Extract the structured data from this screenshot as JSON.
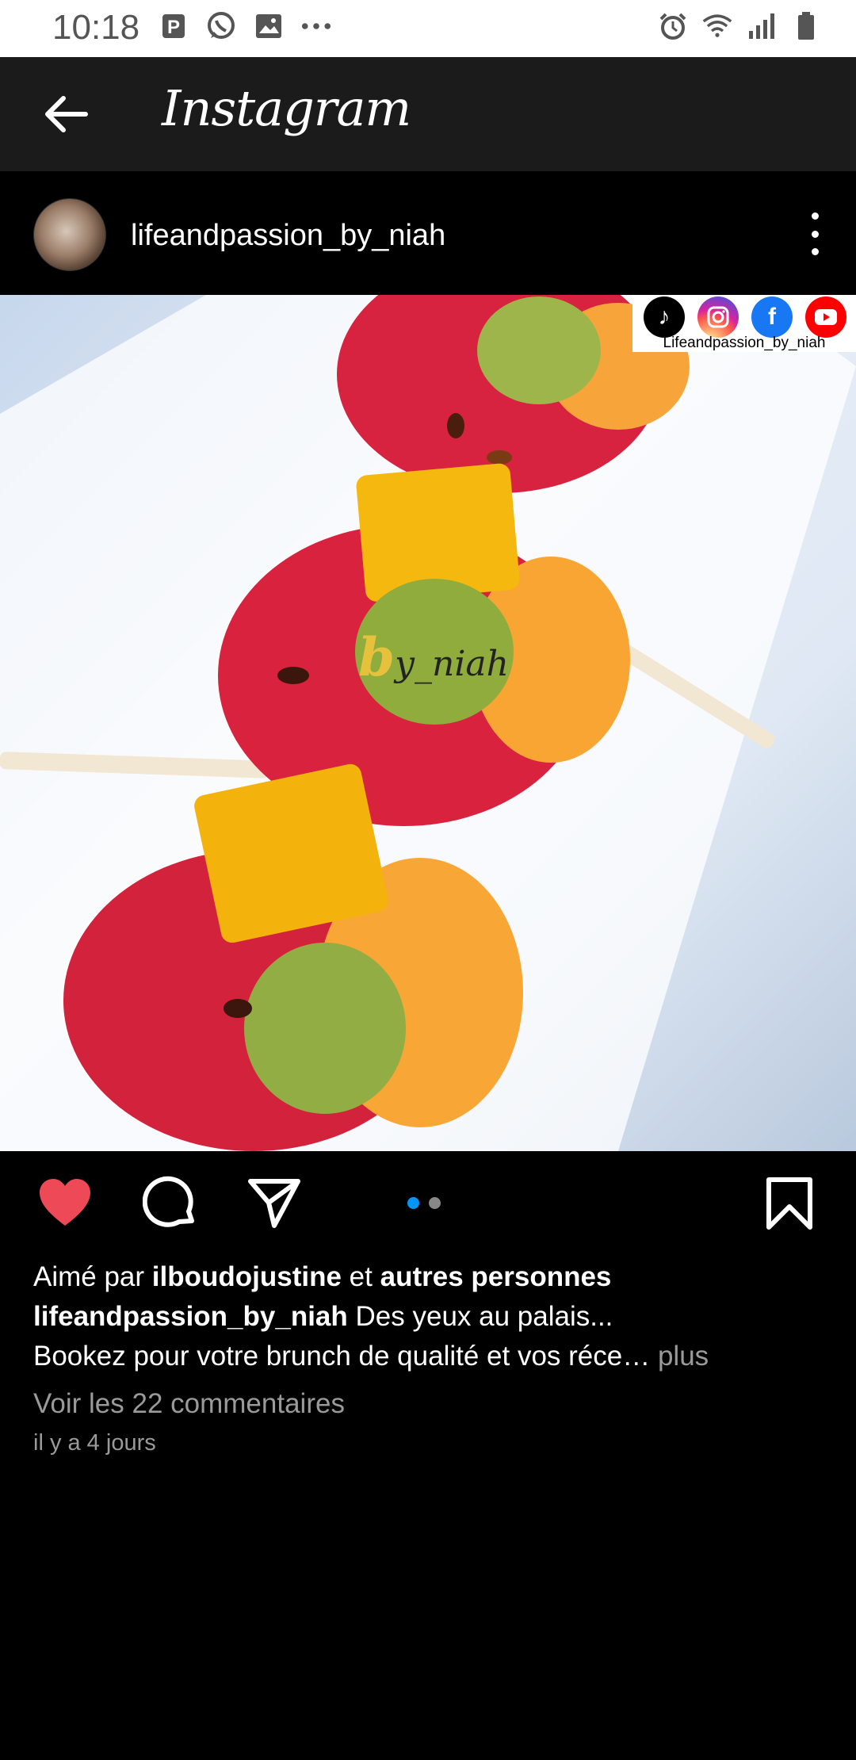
{
  "status_bar": {
    "time": "10:18",
    "left_icons": [
      "p-icon",
      "whatsapp-icon",
      "gallery-icon",
      "more-dots-icon"
    ],
    "right_icons": [
      "alarm-icon",
      "wifi-icon",
      "signal-icon",
      "battery-icon"
    ]
  },
  "app_bar": {
    "title": "Instagram"
  },
  "post": {
    "username": "lifeandpassion_by_niah",
    "watermark_text": "Lifeandpassion_by_niah",
    "overlay_brand_prefix": "b",
    "overlay_brand_rest": "y_niah",
    "carousel_count": 2,
    "carousel_active_index": 0,
    "liked_by_prefix": "Aimé par",
    "liked_by_user": "ilboudojustine",
    "liked_by_joiner": "et",
    "liked_by_others": "autres personnes",
    "caption_user": "lifeandpassion_by_niah",
    "caption_line1": "Des yeux au palais...",
    "caption_line2": "Bookez pour votre brunch de qualité et vos réce…",
    "caption_more": "plus",
    "comments_link": "Voir les 22 commentaires",
    "time_ago": "il y a 4 jours"
  },
  "colors": {
    "like": "#ed4956",
    "carousel_active": "#0095f6",
    "tiktok": "#000000",
    "instagram": "#d62976",
    "facebook": "#1877f2",
    "youtube": "#ff0000"
  }
}
